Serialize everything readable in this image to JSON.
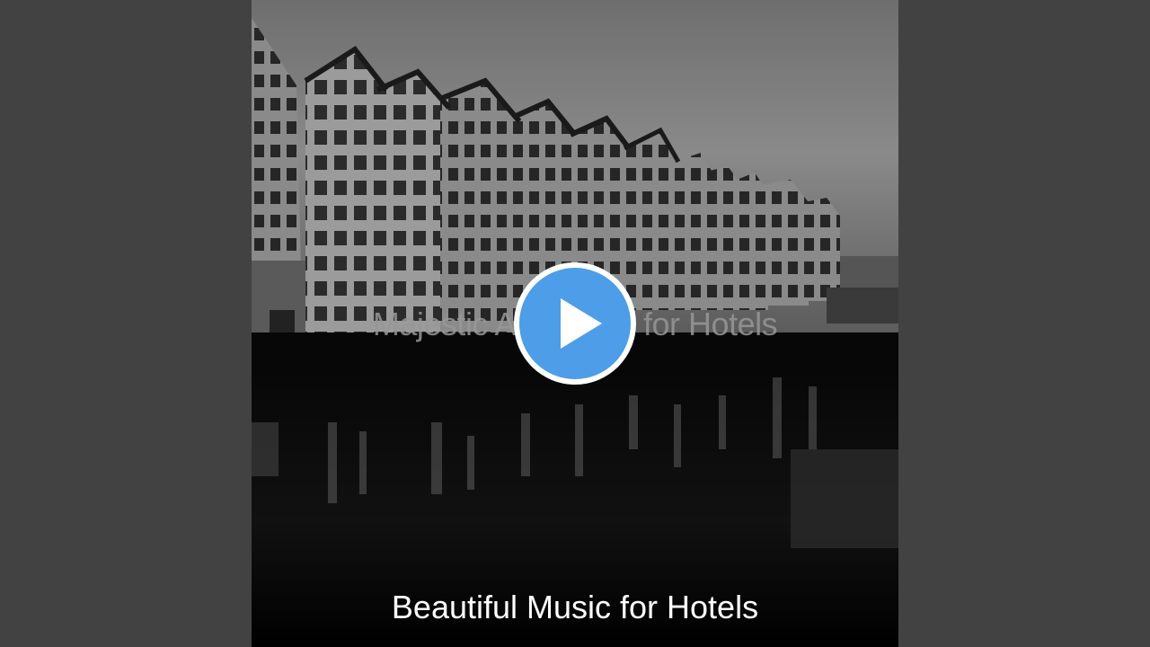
{
  "video": {
    "album_title": "Majestic Ambience for Hotels",
    "caption": "Beautiful Music for Hotels",
    "play_icon": "play-icon",
    "accent_color": "#4d9de8"
  }
}
